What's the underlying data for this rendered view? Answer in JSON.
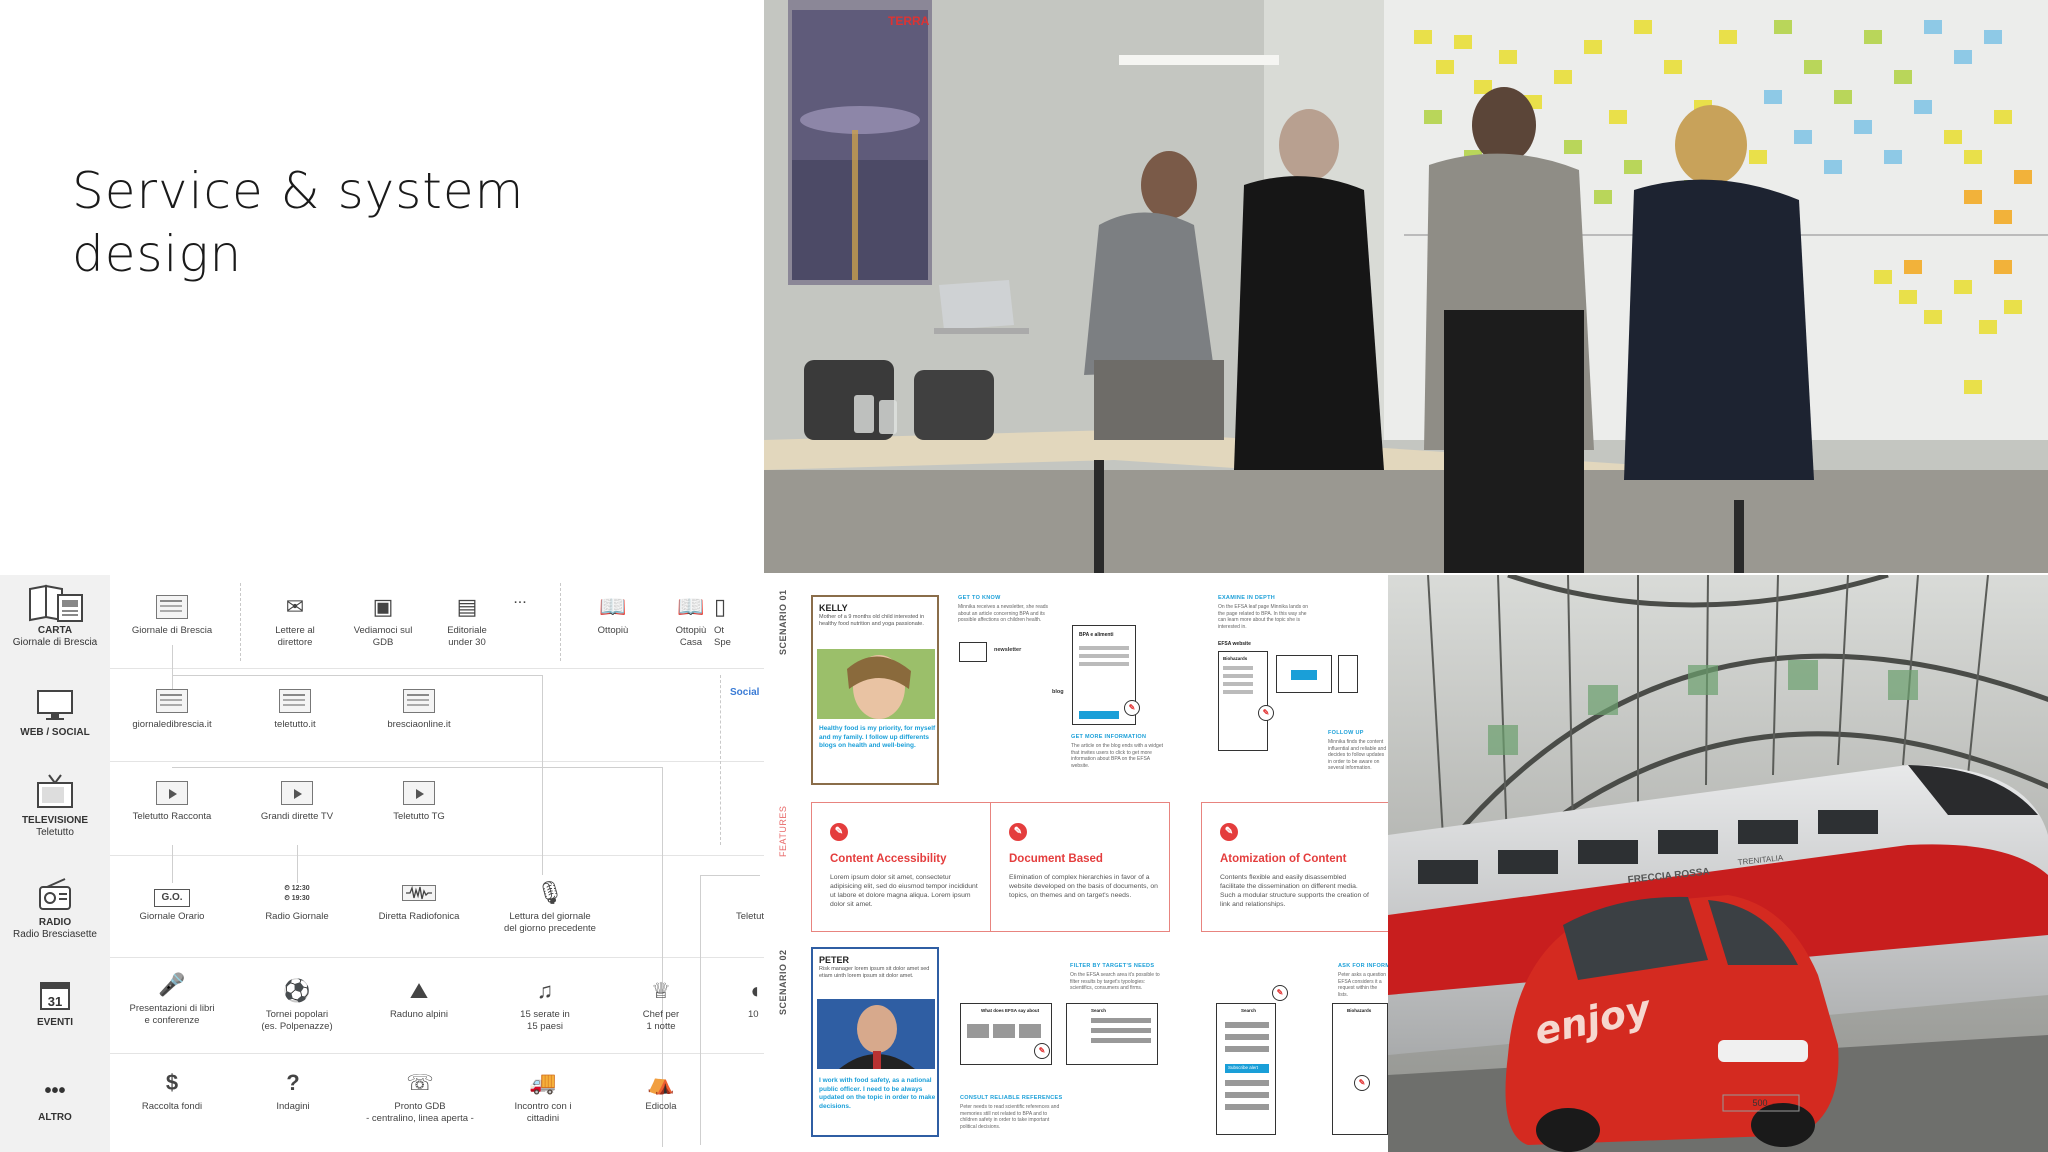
{
  "slide": {
    "title_line1": "Service & system",
    "title_line2": "design"
  },
  "workshop_photo": {
    "poster_brand": "TERRA",
    "accent_colors": {
      "sticky_yellow": "#e9e04a",
      "sticky_green": "#b9d65a",
      "sticky_orange": "#f2b23a",
      "sticky_blue": "#8ec9e6"
    }
  },
  "channel_map": {
    "rows": [
      {
        "icon": "newspaper-icon",
        "label": "CARTA",
        "sub": "Giornale di Brescia"
      },
      {
        "icon": "monitor-icon",
        "label": "WEB / SOCIAL",
        "sub": ""
      },
      {
        "icon": "television-icon",
        "label": "TELEVISIONE",
        "sub": "Teletutto"
      },
      {
        "icon": "radio-icon",
        "label": "RADIO",
        "sub": "Radio Bresciasette"
      },
      {
        "icon": "calendar-icon",
        "label": "EVENTI",
        "sub": "",
        "glyph": "31"
      },
      {
        "icon": "more-icon",
        "label": "ALTRO",
        "sub": "",
        "glyph": "•••"
      }
    ],
    "nodes": {
      "carta": [
        {
          "label": "Giornale di Brescia"
        },
        {
          "label": "Lettere al\ndirettore"
        },
        {
          "label": "Vediamoci sul\nGDB"
        },
        {
          "label": "Editoriale\nunder 30"
        },
        {
          "label": "..."
        },
        {
          "label": "Ottopiù"
        },
        {
          "label": "Ottopiù\nCasa"
        },
        {
          "label": "Ot\nSpe"
        }
      ],
      "web": [
        {
          "label": "giornaledibrescia.it"
        },
        {
          "label": "teletutto.it"
        },
        {
          "label": "bresciaonline.it"
        }
      ],
      "social_label": "Social",
      "tv": [
        {
          "label": "Teletutto Racconta"
        },
        {
          "label": "Grandi dirette TV"
        },
        {
          "label": "Teletutto TG"
        }
      ],
      "radio": [
        {
          "label": "Giornale Orario",
          "glyph": "G.O."
        },
        {
          "label": "Radio Giornale",
          "glyph": "⏲ 12:30\n⏲ 19:30"
        },
        {
          "label": "Diretta Radiofonica"
        },
        {
          "label": "Lettura del giornale\ndel giorno precedente"
        },
        {
          "label": "Teletut"
        }
      ],
      "eventi": [
        {
          "label": "Presentazioni di libri\ne conferenze"
        },
        {
          "label": "Tornei popolari\n(es. Polpenazze)"
        },
        {
          "label": "Raduno alpini"
        },
        {
          "label": "15 serate in\n15 paesi"
        },
        {
          "label": "Chef per\n1 notte"
        },
        {
          "label": "10"
        }
      ],
      "altro": [
        {
          "label": "Raccolta fondi",
          "glyph": "$"
        },
        {
          "label": "Indagini",
          "glyph": "?"
        },
        {
          "label": "Pronto GDB\n- centralino, linea aperta -"
        },
        {
          "label": "Incontro con i\ncittadini"
        },
        {
          "label": "Edicola"
        }
      ]
    }
  },
  "scenario_poster": {
    "scenario1_tag": "SCENARIO 01",
    "features_tag": "FEATURES",
    "scenario2_tag": "SCENARIO 02",
    "kelly": {
      "name": "KELLY",
      "desc": "Mother of a 9 months old child interested in healthy food nutrition and yoga passionate.",
      "quote": "Healthy food is my priority, for myself and my family. I follow up differents blogs on health and well-being."
    },
    "peter": {
      "name": "PETER",
      "desc": "Risk manager lorem ipsum sit dolor amet sed etiam uinth lorem ipsum sit dolor amet.",
      "quote": "I work with food safety, as a national public officer. I need to be always updated on the topic in order to make decisions."
    },
    "steps1": [
      {
        "label": "GET TO KNOW",
        "body": "Minnika receives a newsletter, she reads about an article concerning BPA and its possible affections on children health."
      },
      {
        "label": "GET MORE INFORMATION",
        "body": "The article on the blog ends with a widget that invites users to click to get more information about BPA on the EFSA website."
      },
      {
        "label": "EXAMINE IN DEPTH",
        "body": "On the EFSA leaf page Minnika lands on the page related to BPA. In this way she can learn more about the topic she is interested in."
      },
      {
        "label": "FOLLOW UP",
        "body": "Minnika finds the content influential and reliable and decides to follow updates in order to be aware on several information."
      }
    ],
    "mock_labels": {
      "newsletter": "newsletter",
      "blog": "blog",
      "bpa": "BPA e alimenti",
      "efsa_website": "EFSA website",
      "efsa_btn": "EFSA website",
      "biohazards": "Biohazards"
    },
    "features": [
      {
        "title": "Content Accessibility",
        "body": "Lorem ipsum dolor sit amet, consectetur adipisicing elit, sed do eiusmod tempor incididunt ut labore et dolore magna aliqua. Lorem ipsum dolor sit amet."
      },
      {
        "title": "Document Based",
        "body": "Elimination of complex hierarchies in favor of a website developed on the basis of documents, on topics, on themes and on target's needs."
      },
      {
        "title": "Atomization of Content",
        "body": "Contents flexible and easily disassembled facilitate the dissemination on different media. Such a modular structure supports the creation of link and relationships."
      }
    ],
    "steps2": [
      {
        "label": "FILTER BY TARGET'S NEEDS",
        "body": "On the EFSA search area it's possible to filter results by target's typologies: scientifics, consumers and firms."
      },
      {
        "label": "CONSULT RELIABLE REFERENCES",
        "body": "Peter needs to read scientific references and memories still not related to BPA and to children safety in order to take important political decisions."
      },
      {
        "label": "ASK FOR INFORM",
        "body": "Peter asks a question EFSA considers it a request within the lists."
      }
    ],
    "mock_labels2": {
      "what_does": "What does EFSA say about",
      "search": "Search",
      "search2": "Search",
      "subscribe": "Subscribe alert",
      "biohazards": "Biohazards"
    }
  },
  "train_photo": {
    "train_brand": "FRECCIA ROSSA",
    "rail_brand": "TRENITALIA",
    "car_brand": "enjoy",
    "car_badge": "500",
    "colors": {
      "train_red": "#c81e1e",
      "car_red": "#d42a20"
    }
  }
}
